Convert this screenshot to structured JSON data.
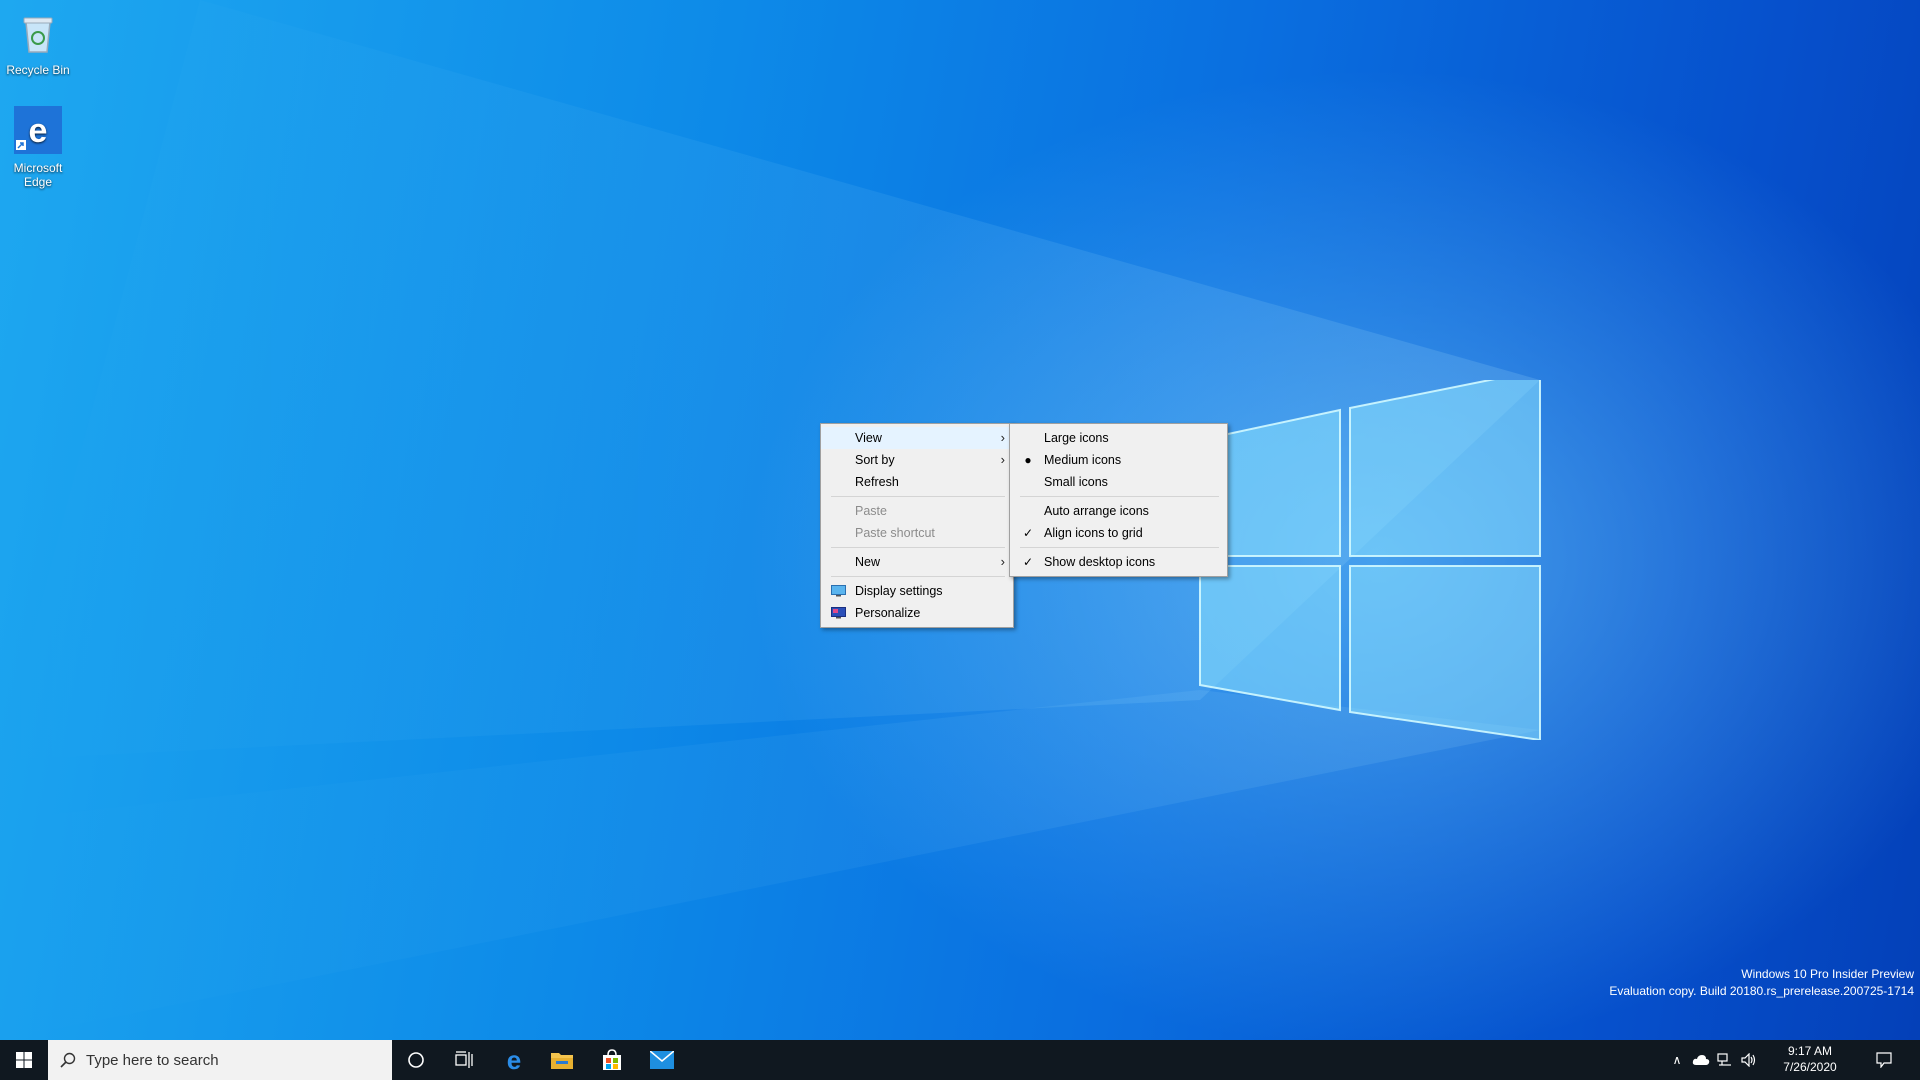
{
  "desktop": {
    "icons": [
      {
        "label": "Recycle Bin"
      },
      {
        "label": "Microsoft Edge"
      }
    ]
  },
  "context_menu": {
    "items": [
      {
        "label": "View"
      },
      {
        "label": "Sort by"
      },
      {
        "label": "Refresh"
      },
      {
        "label": "Paste"
      },
      {
        "label": "Paste shortcut"
      },
      {
        "label": "New"
      },
      {
        "label": "Display settings"
      },
      {
        "label": "Personalize"
      }
    ]
  },
  "view_submenu": {
    "items": [
      {
        "label": "Large icons"
      },
      {
        "label": "Medium icons"
      },
      {
        "label": "Small icons"
      },
      {
        "label": "Auto arrange icons"
      },
      {
        "label": "Align icons to grid"
      },
      {
        "label": "Show desktop icons"
      }
    ]
  },
  "watermark": {
    "line1": "Windows 10 Pro Insider Preview",
    "line2": "Evaluation copy. Build 20180.rs_prerelease.200725-1714"
  },
  "taskbar": {
    "search_placeholder": "Type here to search",
    "time": "9:17 AM",
    "date": "7/26/2020",
    "pinned": [
      "cortana-icon",
      "task-view-icon",
      "edge-icon",
      "file-explorer-icon",
      "store-icon",
      "mail-icon"
    ]
  },
  "colors": {
    "taskbar": "#101820",
    "menu_bg": "#f0f0f0",
    "menu_highlight": "#e5f3ff",
    "accent": "#0078d7"
  }
}
